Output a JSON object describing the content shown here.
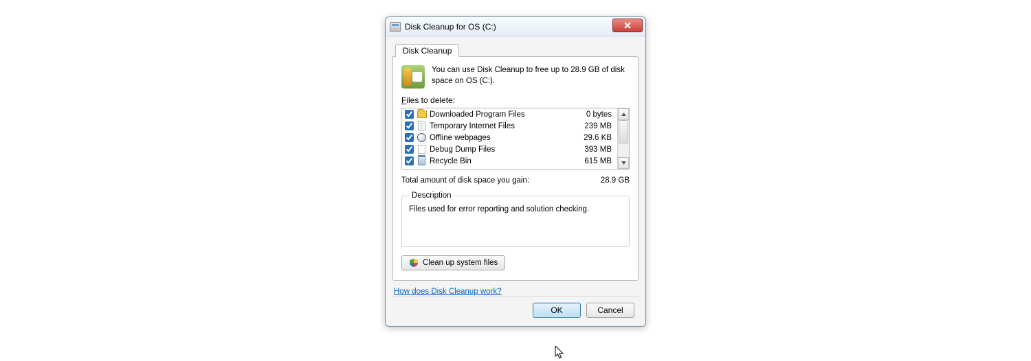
{
  "window": {
    "title": "Disk Cleanup for OS (C:)"
  },
  "tab": {
    "label": "Disk Cleanup"
  },
  "intro": "You can use Disk Cleanup to free up to 28.9 GB of disk space on OS (C:).",
  "files_label_pre": "F",
  "files_label_post": "iles to delete:",
  "items": [
    {
      "name": "Downloaded Program Files",
      "size": "0 bytes",
      "checked": true,
      "icon": "folder"
    },
    {
      "name": "Temporary Internet Files",
      "size": "239 MB",
      "checked": true,
      "icon": "page"
    },
    {
      "name": "Offline webpages",
      "size": "29.6 KB",
      "checked": true,
      "icon": "globe"
    },
    {
      "name": "Debug Dump Files",
      "size": "393 MB",
      "checked": true,
      "icon": "blank"
    },
    {
      "name": "Recycle Bin",
      "size": "615 MB",
      "checked": true,
      "icon": "bin"
    }
  ],
  "total": {
    "label": "Total amount of disk space you gain:",
    "value": "28.9 GB"
  },
  "description": {
    "legend": "Description",
    "text": "Files used for error reporting and solution checking."
  },
  "clean_btn": "Clean up system files",
  "help_link": "How does Disk Cleanup work?",
  "buttons": {
    "ok": "OK",
    "cancel": "Cancel"
  }
}
